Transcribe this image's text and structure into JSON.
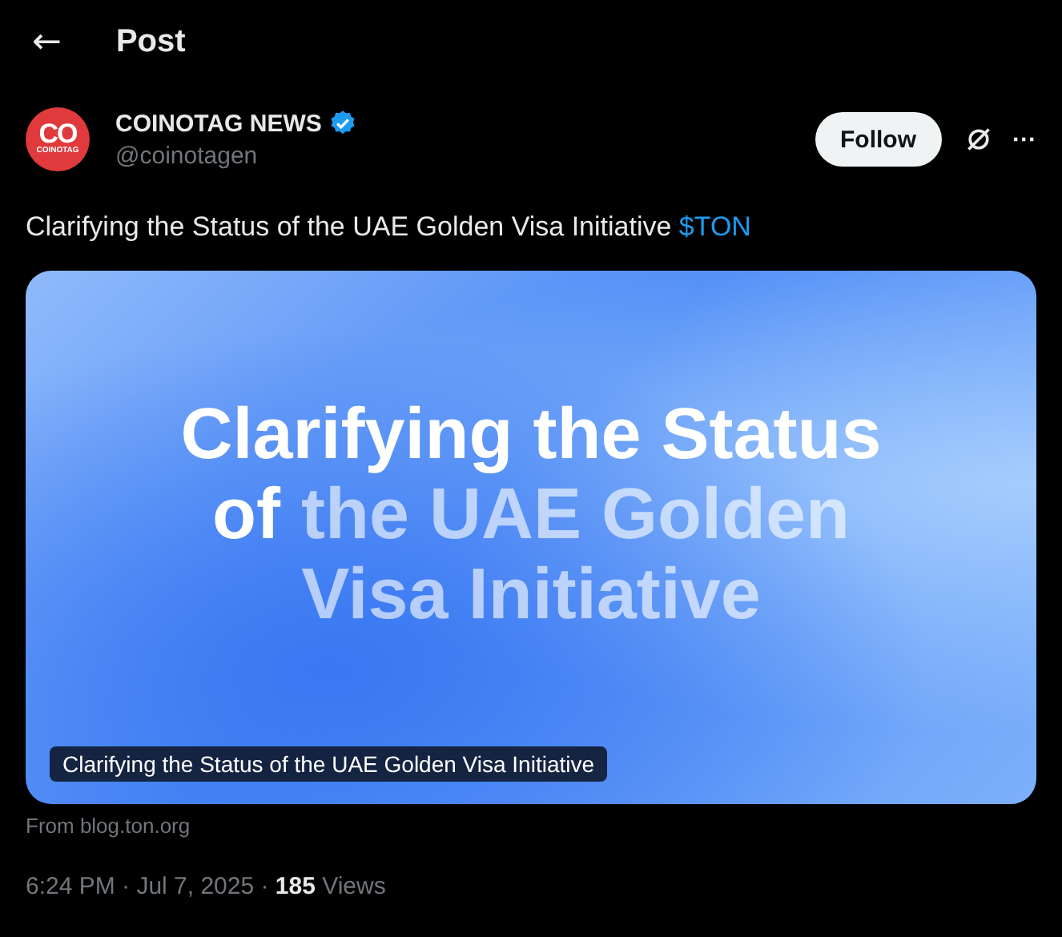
{
  "header": {
    "back": "←",
    "title": "Post"
  },
  "author": {
    "avatar_mark": "CO",
    "avatar_caption": "COINOTAG",
    "name": "COINOTAG NEWS",
    "verified": true,
    "handle": "@coinotagen"
  },
  "follow_button": "Follow",
  "more": "···",
  "text": "Clarifying the Status of the UAE Golden Visa Initiative",
  "hashtag": "$TON",
  "card": {
    "headline": [
      [
        {
          "text": "Clarifying the Status",
          "faded": false
        }
      ],
      [
        {
          "text": "of",
          "faded": false
        },
        {
          "text": "the UAE Golden",
          "faded": true
        }
      ],
      [
        {
          "text": "Visa Initiative",
          "faded": true
        }
      ]
    ],
    "caption": "Clarifying the Status of the UAE Golden Visa Initiative",
    "source": "From blog.ton.org"
  },
  "meta": "6:24 PM · Jul 7, 2025 · **185** Views"
}
